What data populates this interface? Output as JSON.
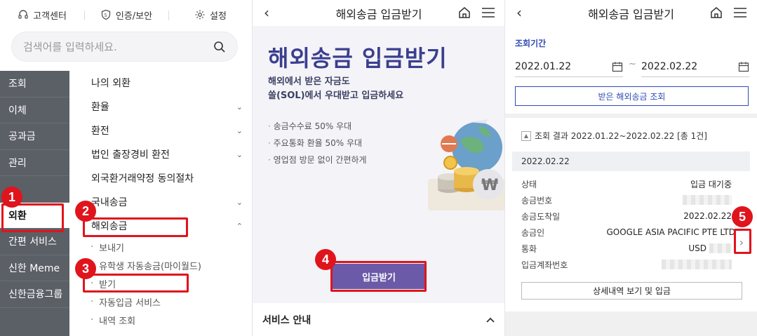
{
  "panel1": {
    "topbar": [
      {
        "label": "고객센터",
        "icon": "headset-icon"
      },
      {
        "label": "인증/보안",
        "icon": "shield-icon"
      },
      {
        "label": "설정",
        "icon": "gear-icon"
      }
    ],
    "search": {
      "placeholder": "검색어를 입력하세요."
    },
    "leftnav": [
      "조회",
      "이체",
      "공과금",
      "관리",
      "",
      "외환",
      "간편 서비스",
      "신한 Meme",
      "신한금융그룹"
    ],
    "submenu": {
      "items": [
        {
          "label": "나의 외환",
          "chev": ""
        },
        {
          "label": "환율",
          "chev": "⌄"
        },
        {
          "label": "환전",
          "chev": "⌄"
        },
        {
          "label": "법인 출장경비 환전",
          "chev": "⌄"
        },
        {
          "label": "외국환거래약정 동의절차",
          "chev": ""
        },
        {
          "label": "국내송금",
          "chev": "⌄"
        },
        {
          "label": "해외송금",
          "chev": "⌃"
        }
      ],
      "subitems": [
        "보내기",
        "유학생 자동송금(마이월드)",
        "받기",
        "자동입금 서비스",
        "내역 조회"
      ]
    }
  },
  "panel2": {
    "header": "해외송금 입금받기",
    "title": "해외송금 입금받기",
    "subtitle1": "해외에서 받은 자금도",
    "subtitle2": "쏠(SOL)에서 우대받고 입금하세요",
    "bullets": [
      "송금수수료 50% 우대",
      "주요통화 환율 50% 우대",
      "영업점 방문 없이 간편하게"
    ],
    "cta": "입금받기",
    "service": "서비스 안내"
  },
  "panel3": {
    "header": "해외송금 입금받기",
    "period_label": "조회기간",
    "date_from": "2022.01.22",
    "date_to": "2022.02.22",
    "tilde": "~",
    "query_button": "받은 해외송금 조회",
    "result": "조회 결과 2022.01.22~2022.02.22 [총 1건]",
    "date_bar": "2022.02.22",
    "rows": [
      {
        "k": "상태",
        "v": "입금 대기중"
      },
      {
        "k": "송금번호",
        "v": ""
      },
      {
        "k": "송금도착일",
        "v": "2022.02.22"
      },
      {
        "k": "송금인",
        "v": "GOOGLE ASIA PACIFIC PTE LTD"
      },
      {
        "k": "통화",
        "v": "USD"
      },
      {
        "k": "입금계좌번호",
        "v": ""
      }
    ],
    "detail_button": "상세내역 보기 및 입금"
  },
  "annotations": [
    "1",
    "2",
    "3",
    "4",
    "5"
  ],
  "colors": {
    "accent_red": "#e0141c",
    "nav_gray": "#5b5f66",
    "cta_purple": "#6a5aa8",
    "link_blue": "#2f4bb5"
  }
}
